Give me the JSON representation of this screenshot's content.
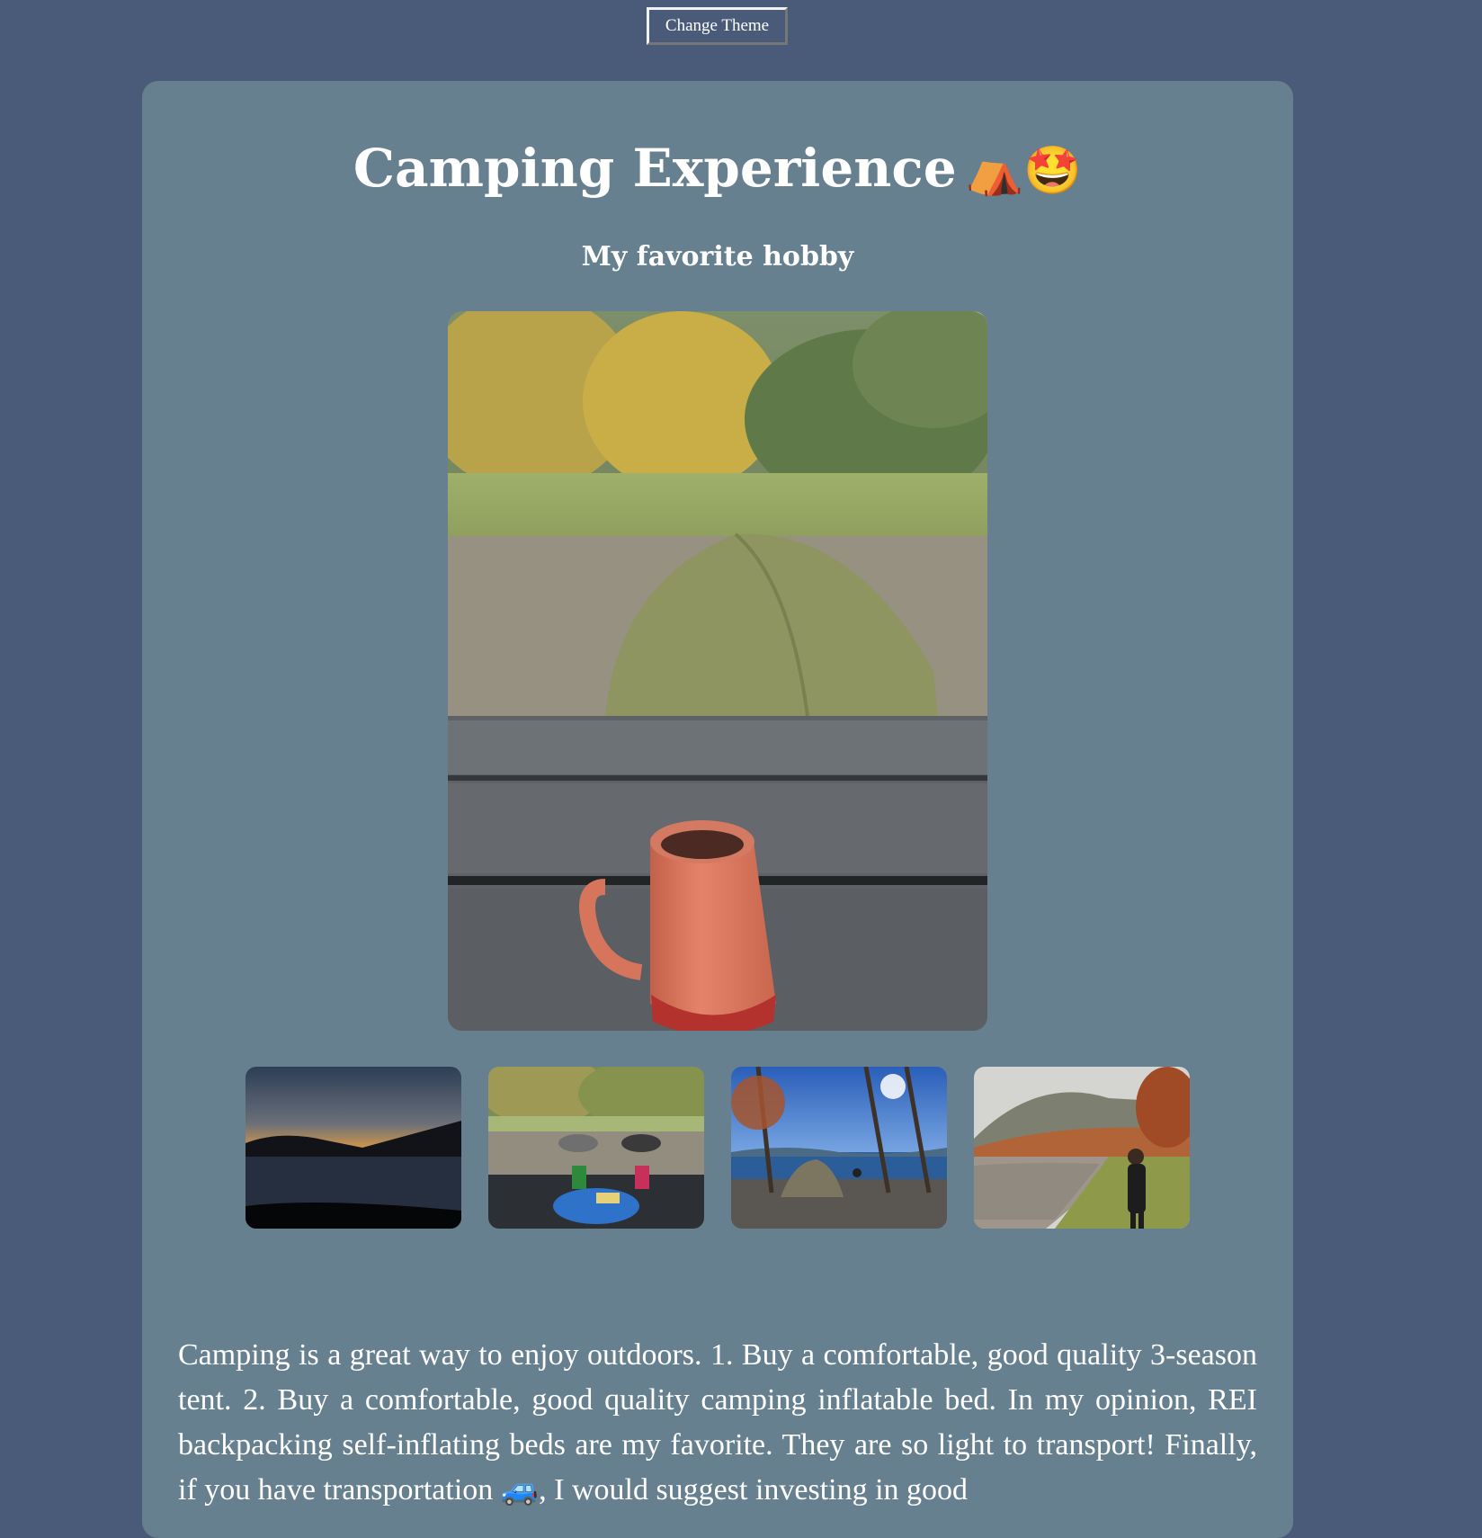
{
  "header": {
    "theme_button_label": "Change Theme"
  },
  "page": {
    "title": "Camping Experience",
    "title_emoji": "⛺🤩",
    "subtitle": "My favorite hobby"
  },
  "gallery": {
    "hero_image": "tent-and-mug-photo",
    "thumbnails": [
      "lake-sunset-photo",
      "camp-stove-breakfast-photo",
      "lakeside-tent-photo",
      "person-by-river-photo"
    ]
  },
  "content": {
    "description": "Camping is a great way to enjoy outdoors. 1. Buy a comfortable, good quality 3-season tent. 2. Buy a comfortable, good quality camping inflatable bed. In my opinion, REI backpacking self-inflating beds are my favorite. They are so light to transport! Finally, if you have transportation 🚙, I would suggest investing in good"
  },
  "colors": {
    "background": "#4a5b79",
    "card": "#67808f",
    "text": "#ffffff"
  }
}
